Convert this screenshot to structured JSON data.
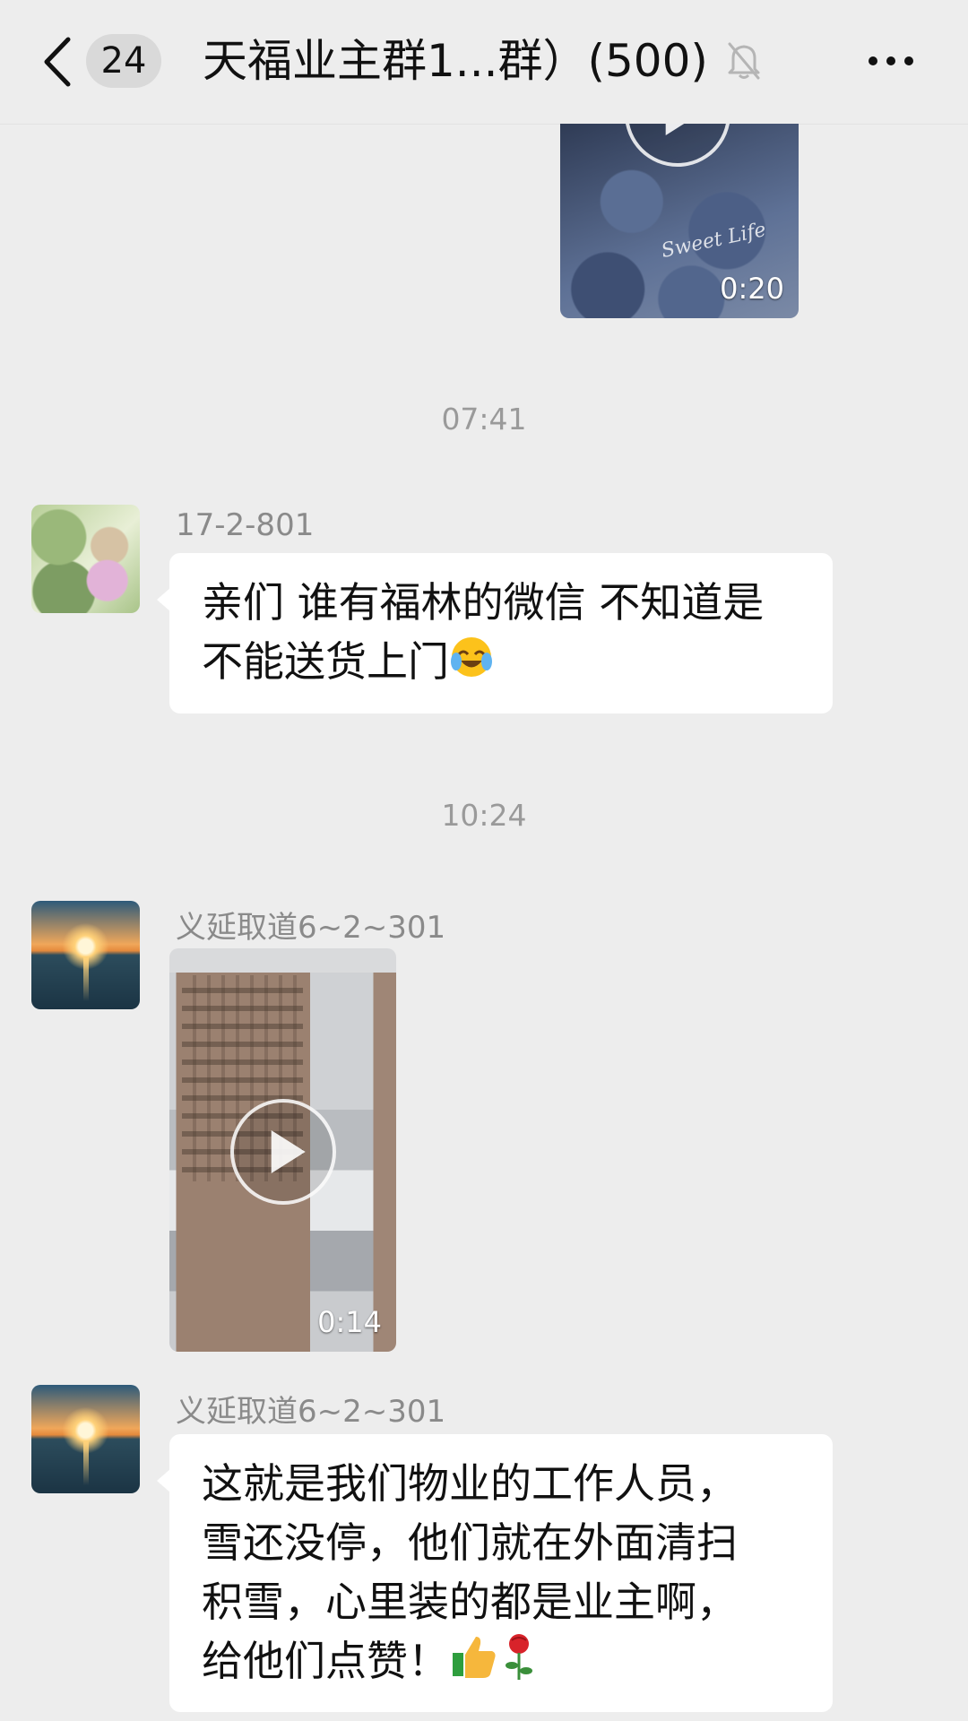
{
  "header": {
    "back_icon": "chevron-left-icon",
    "unread_count": "24",
    "title": "天福业主群1...群）(500)",
    "mute_icon": "bell-muted-icon",
    "more_icon": "more-dots-icon"
  },
  "messages": [
    {
      "type": "video",
      "duration": "0:20",
      "overlay_text": "Sweet Life"
    },
    {
      "type": "time",
      "text": "07:41"
    },
    {
      "type": "text",
      "sender": "17-2-801",
      "lines": [
        "亲们 谁有福林的微信 不知道是",
        "不能送货上门"
      ],
      "emoji": "crying-laughing-emoji"
    },
    {
      "type": "time",
      "text": "10:24"
    },
    {
      "type": "video",
      "sender": "义延取道6~2~301",
      "duration": "0:14"
    },
    {
      "type": "text",
      "sender": "义延取道6~2~301",
      "lines": [
        "这就是我们物业的工作人员，",
        "雪还没停，他们就在外面清扫",
        "积雪，心里装的都是业主啊，",
        "给他们点赞！"
      ],
      "emojis": [
        "thumbs-up-emoji",
        "rose-emoji"
      ]
    }
  ],
  "colors": {
    "background": "#ededed",
    "bubble": "#ffffff",
    "meta_text": "#9a9a9a"
  }
}
